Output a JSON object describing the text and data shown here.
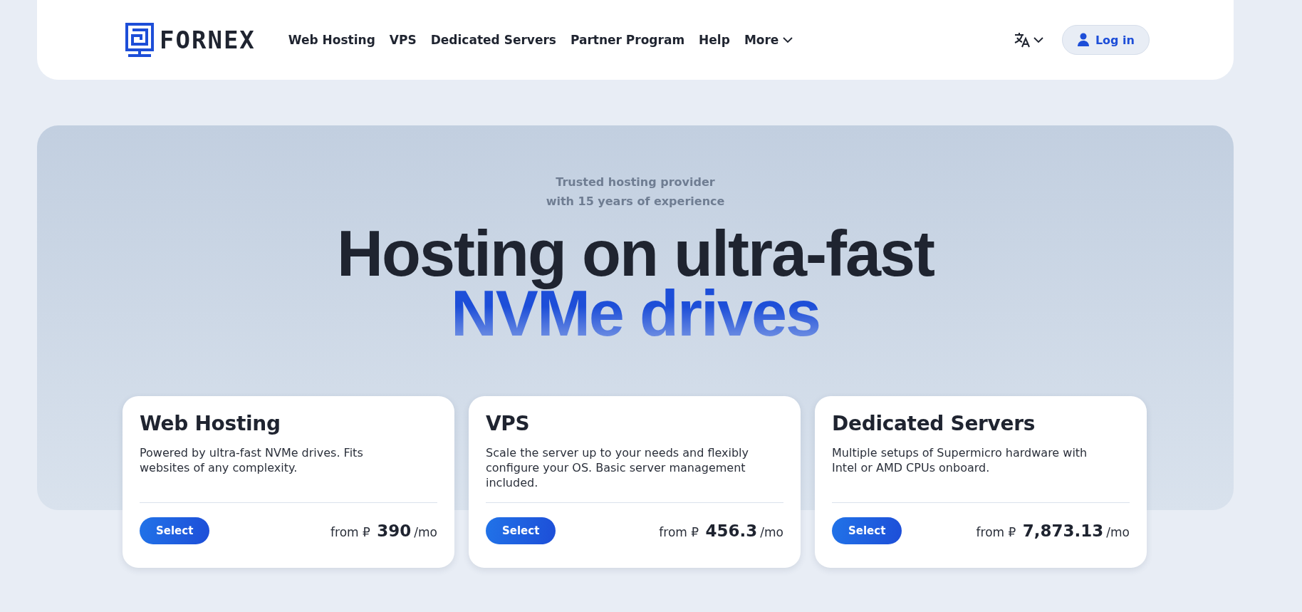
{
  "header": {
    "logo": {
      "text": "FORNEX"
    },
    "nav": [
      {
        "label": "Web Hosting",
        "kind": "link"
      },
      {
        "label": "VPS",
        "kind": "link"
      },
      {
        "label": "Dedicated Servers",
        "kind": "link"
      },
      {
        "label": "Partner Program",
        "kind": "link"
      },
      {
        "label": "Help",
        "kind": "link"
      },
      {
        "label": "More",
        "kind": "menu"
      }
    ],
    "login": {
      "label": "Log in"
    }
  },
  "hero": {
    "tagline": [
      "Trusted hosting provider",
      "with 15 years of experience"
    ],
    "title": "Hosting on ultra-fast",
    "title_accent": "NVMe drives"
  },
  "cards": [
    {
      "title": "Web Hosting",
      "description": "Powered by ultra-fast NVMe drives. Fits websites of any complexity.",
      "button": "Select",
      "price_prefix": "from ₽",
      "price": "390",
      "price_unit": "/mo"
    },
    {
      "title": "VPS",
      "description": "Scale the server up to your needs and flexibly configure your OS. Basic server management included.",
      "button": "Select",
      "price_prefix": "from ₽",
      "price": "456.3",
      "price_unit": "/mo"
    },
    {
      "title": "Dedicated Servers",
      "description": "Multiple setups of Supermicro hardware with Intel or AMD CPUs onboard.",
      "button": "Select",
      "price_prefix": "from ₽",
      "price": "7,873.13",
      "price_unit": "/mo"
    }
  ]
}
